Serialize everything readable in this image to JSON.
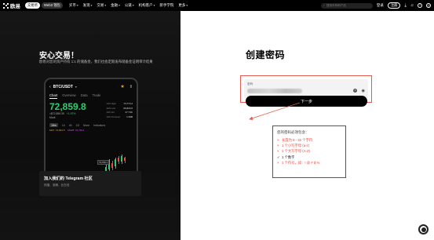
{
  "nav": {
    "brand": "欧易",
    "mode_tabs": [
      "交易所",
      "Web3 钱包"
    ],
    "items": [
      "买币",
      "发现",
      "交易",
      "金融",
      "公链",
      "机构客户",
      "新手学院",
      "更多"
    ],
    "search_placeholder": "搜索币种和产品",
    "login": "登录",
    "register": "注册"
  },
  "promo": {
    "title": "安心交易！",
    "description": "欧易对您的资产持有 1:1 的储备金，我们也会定期发布储备金证明审计结果",
    "phone": {
      "pair": "BTC/USDT",
      "tabs": [
        "Chart",
        "Overview",
        "Data",
        "Trade"
      ],
      "price": "72,859.8",
      "price_sub": "≈$72,859.39",
      "change": "+1.97%",
      "mark_label": "Mark",
      "stats": [
        [
          "24h High",
          "73,774.2"
        ],
        [
          "24h Low",
          "69,823.0"
        ],
        [
          "24h Vol",
          "27.74K"
        ],
        [
          "24h Turnover",
          "1.99B"
        ]
      ],
      "timeframes": [
        "15m",
        "1h",
        "4h",
        "1D",
        "More",
        "Indicators"
      ],
      "ma": [
        "MA7: 72,831.5",
        "MA25: 72,743.1"
      ],
      "price_tag": "72,760.1"
    },
    "community_title": "加入我们的 Telegram 社区",
    "community_sub": "快捷、准确、比在线"
  },
  "form": {
    "title": "创建密码",
    "password_label": "密码",
    "password_value": "••••••••••••",
    "next_button": "下一步",
    "rules_title": "您的密码必须包含：",
    "rules": [
      {
        "mark": "×",
        "text": "长度为 8 - 32 个字符",
        "ok": false
      },
      {
        "mark": "×",
        "text": "1 个小写字母 (a-z)",
        "ok": false
      },
      {
        "mark": "×",
        "text": "1 个大写字母 (A-Z)",
        "ok": false
      },
      {
        "mark": "✓",
        "text": "1 个数字",
        "ok": true
      },
      {
        "mark": "×",
        "text": "1 个符号，如：! @ # $ %",
        "ok": false
      }
    ]
  },
  "colors": {
    "accent_green": "#2ecc71",
    "error_red": "#e8413a",
    "highlight_border": "#e85a4f"
  }
}
